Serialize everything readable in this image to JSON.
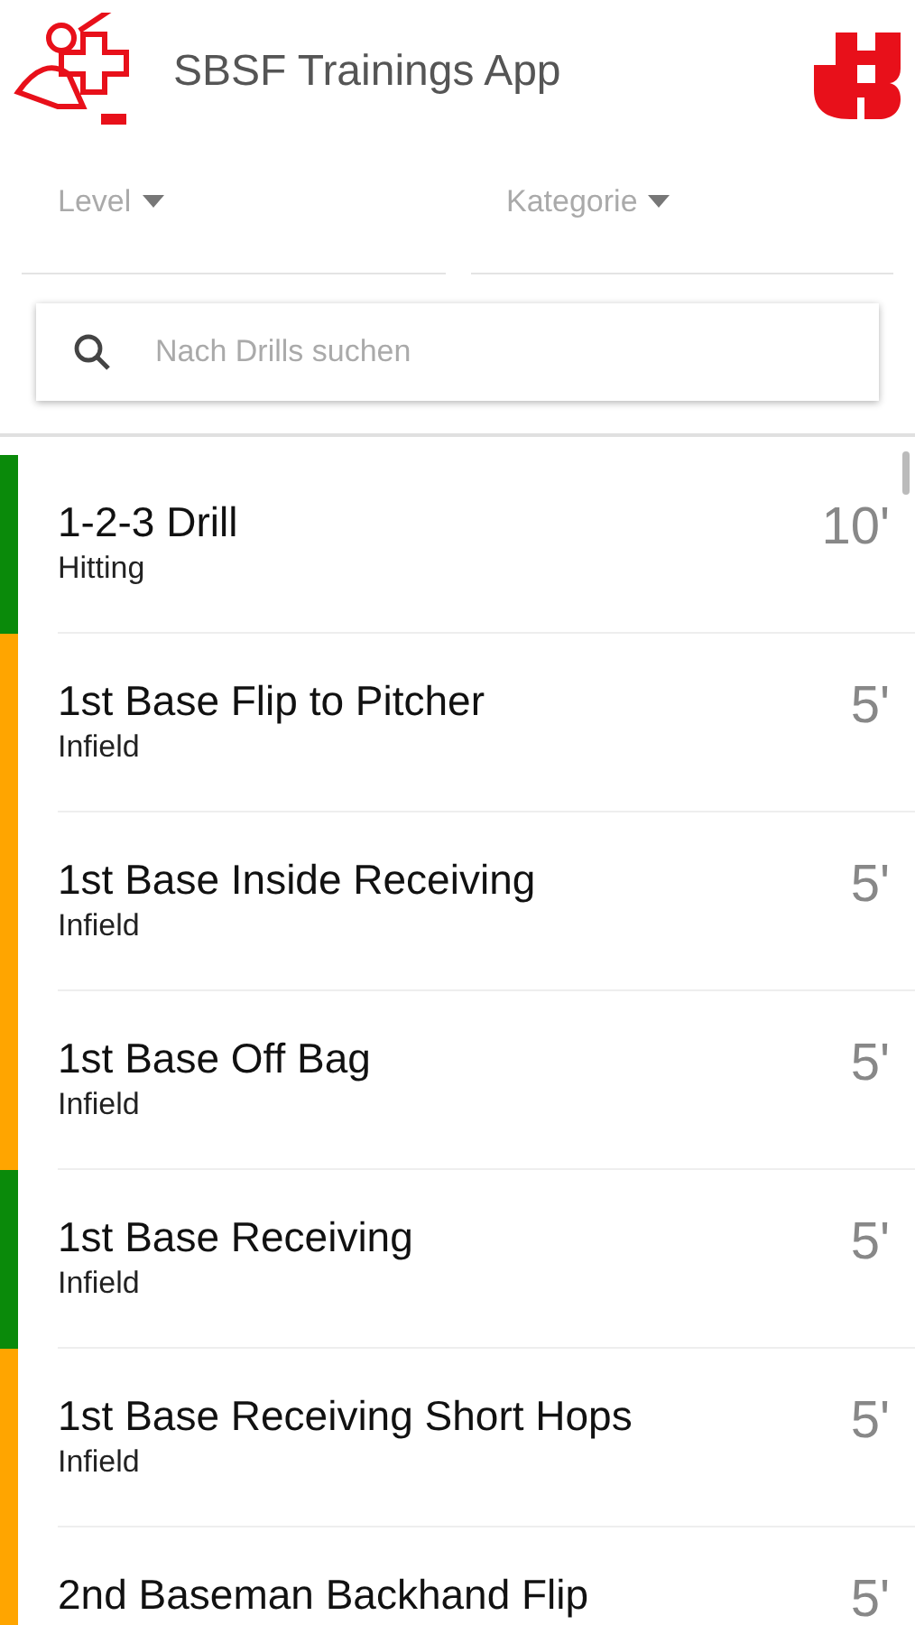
{
  "header": {
    "title": "SBSF Trainings App"
  },
  "filters": [
    {
      "label": "Level"
    },
    {
      "label": "Kategorie"
    }
  ],
  "search": {
    "placeholder": "Nach Drills suchen"
  },
  "drills": [
    {
      "title": "1-2-3 Drill",
      "category": "Hitting",
      "duration": "10'",
      "color": "#0a8a0a"
    },
    {
      "title": "1st Base Flip to Pitcher",
      "category": "Infield",
      "duration": "5'",
      "color": "#ffa500"
    },
    {
      "title": "1st Base Inside Receiving",
      "category": "Infield",
      "duration": "5'",
      "color": "#ffa500"
    },
    {
      "title": "1st Base Off Bag",
      "category": "Infield",
      "duration": "5'",
      "color": "#ffa500"
    },
    {
      "title": "1st Base Receiving",
      "category": "Infield",
      "duration": "5'",
      "color": "#0a8a0a"
    },
    {
      "title": "1st Base Receiving Short Hops",
      "category": "Infield",
      "duration": "5'",
      "color": "#ffa500"
    },
    {
      "title": "2nd Baseman Backhand Flip",
      "duration": "5'",
      "color": "#ffa500"
    }
  ]
}
